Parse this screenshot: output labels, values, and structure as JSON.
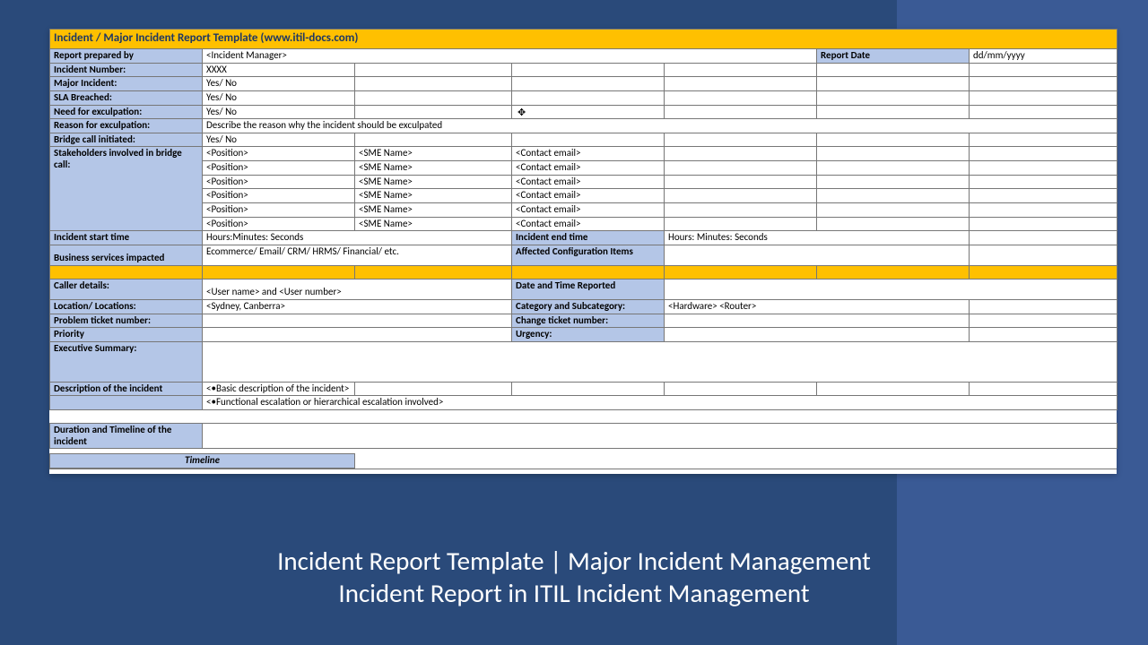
{
  "title": "Incident / Major Incident Report Template   (www.itil-docs.com)",
  "r": {
    "prepared_by": "Report prepared by",
    "prepared_by_v": "<Incident Manager>",
    "report_date": "Report Date",
    "report_date_v": "dd/mm/yyyy",
    "num": "Incident Number:",
    "num_v": "XXXX",
    "major": "Major Incident:",
    "major_v": "Yes/ No",
    "sla": "SLA Breached:",
    "sla_v": "Yes/ No",
    "need_exc": "Need for exculpation:",
    "need_exc_v": "Yes/ No",
    "reason_exc": "Reason for exculpation:",
    "reason_exc_v": "Describe the reason why the incident should be exculpated",
    "bridge": "Bridge call initiated:",
    "bridge_v": "Yes/ No",
    "stake": "Stakeholders involved in bridge call:",
    "pos": "<Position>",
    "sme": "<SME Name>",
    "email": "<Contact email>",
    "start": "Incident start time",
    "start_v": "Hours:Minutes: Seconds",
    "end": "Incident end time",
    "end_v": "Hours: Minutes: Seconds",
    "svc": "Business services impacted",
    "svc_v": "Ecommerce/ Email/ CRM/ HRMS/ Financial/ etc.",
    "aci": "Affected Configuration Items",
    "caller": "Caller details:",
    "caller_v": "<User name> and <User number>",
    "dtr": "Date and Time Reported",
    "loc": "Location/ Locations:",
    "loc_v": "<Sydney, Canberra>",
    "cat": "Category and Subcategory:",
    "cat_v": "<Hardware> <Router>",
    "prob": "Problem ticket number:",
    "chg": "Change ticket number:",
    "prio": "Priority",
    "urg": "Urgency:",
    "exec": "Executive Summary:",
    "desc": "Description of the incident",
    "desc_v": "<•Basic description of the incident>",
    "esc": "<•Functional escalation or hierarchical escalation involved>",
    "dur": "Duration and Timeline of the incident",
    "tl": "Timeline"
  },
  "caption_l1": "Incident Report Template | Major Incident Management",
  "caption_l2": "Incident Report in ITIL Incident Management"
}
